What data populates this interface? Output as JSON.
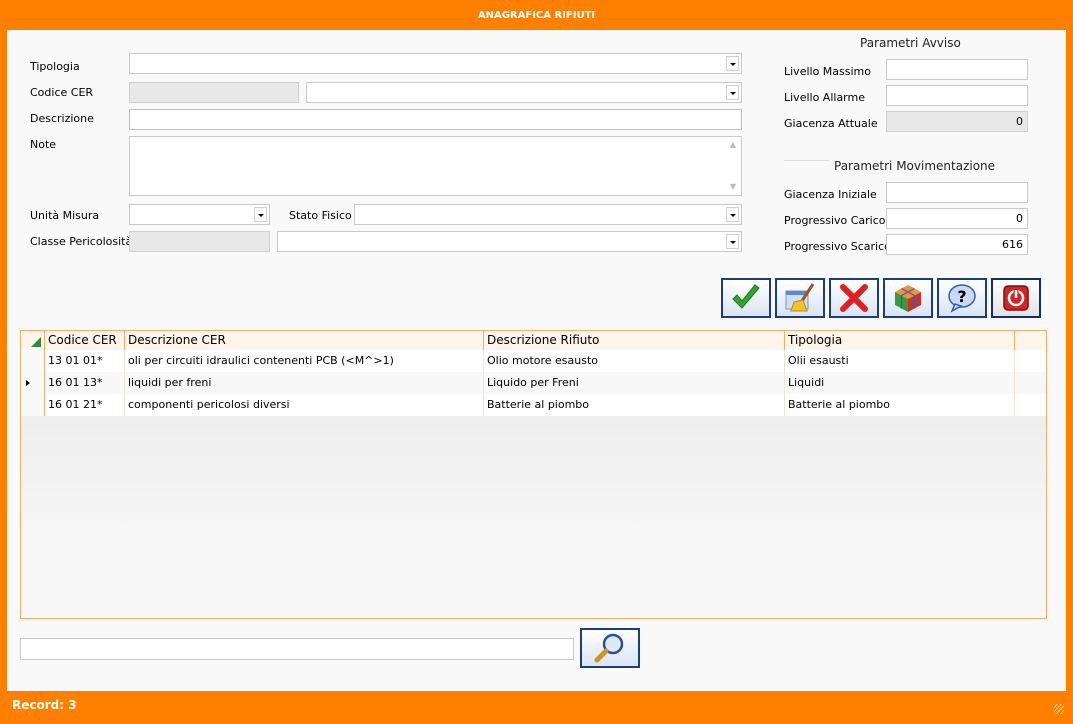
{
  "window": {
    "title": "ANAGRAFICA RIFIUTI"
  },
  "form": {
    "tipologia_label": "Tipologia",
    "codice_cer_label": "Codice CER",
    "descrizione_label": "Descrizione",
    "note_label": "Note",
    "unita_misura_label": "Unità Misura",
    "stato_fisico_label": "Stato Fisico",
    "classe_pericolosita_label": "Classe Pericolosità"
  },
  "avviso": {
    "title": "Parametri Avviso",
    "livello_massimo_label": "Livello Massimo",
    "livello_allarme_label": "Livello Allarme",
    "giacenza_attuale_label": "Giacenza Attuale",
    "giacenza_attuale_value": "0"
  },
  "movimentazione": {
    "title": "Parametri Movimentazione",
    "giacenza_iniziale_label": "Giacenza Iniziale",
    "progressivo_carico_label": "Progressivo Carico",
    "progressivo_carico_value": "0",
    "progressivo_scarico_label": "Progressivo Scarico",
    "progressivo_scarico_value": "616"
  },
  "toolbar": [
    "confirm-icon",
    "clean-icon",
    "delete-icon",
    "cube-icon",
    "help-icon",
    "exit-icon"
  ],
  "grid": {
    "columns": [
      "Codice CER",
      "Descrizione CER",
      "Descrizione Rifiuto",
      "Tipologia"
    ],
    "rows": [
      [
        "13 01 01*",
        "oli per circuiti idraulici contenenti PCB (<M^>1)",
        "Olio motore esausto",
        "Olii esausti"
      ],
      [
        "16 01 13*",
        "liquidi per freni",
        "Liquido per Freni",
        "Liquidi"
      ],
      [
        "16 01 21*",
        "componenti pericolosi diversi",
        "Batterie al piombo",
        "Batterie al piombo"
      ]
    ],
    "current_row": 1
  },
  "status": {
    "text": "Record: 3"
  },
  "colors": {
    "accent": "#ff8000",
    "grid_border": "#f0b070"
  }
}
